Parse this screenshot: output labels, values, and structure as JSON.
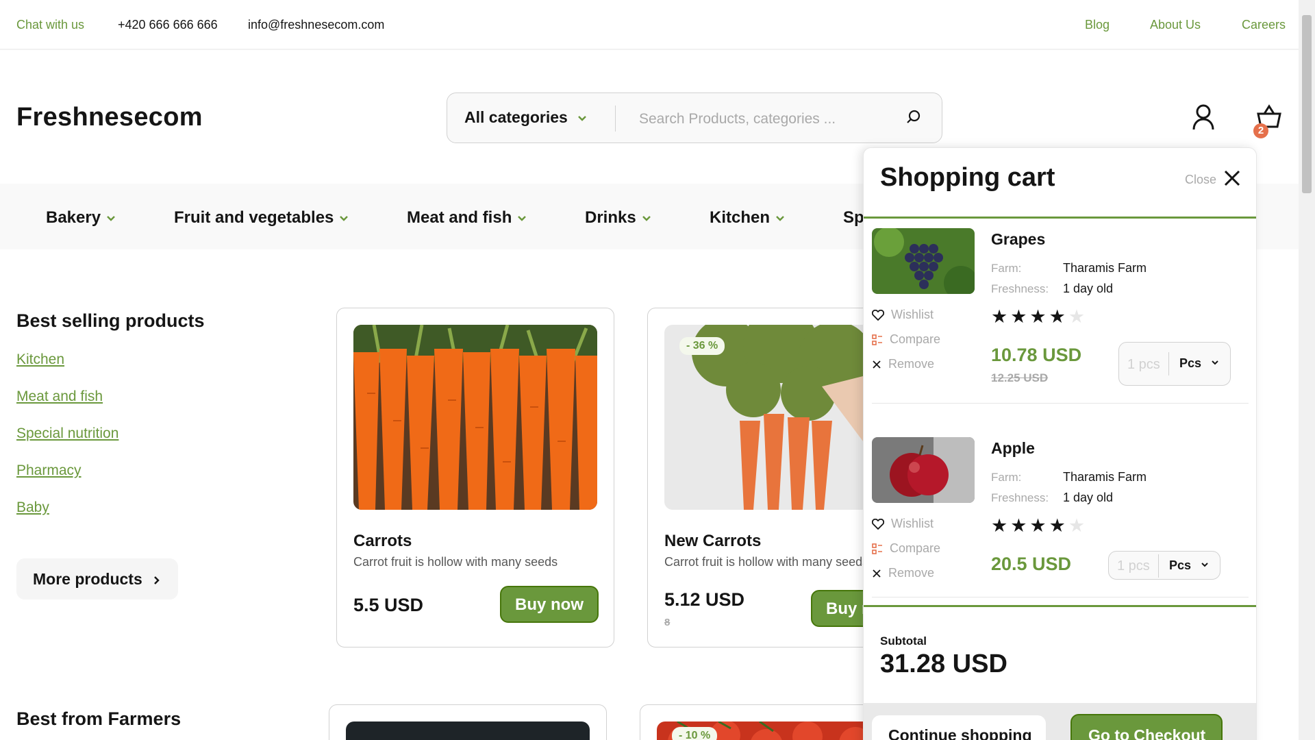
{
  "topbar": {
    "chat": "Chat with us",
    "phone": "+420 666 666 666",
    "email": "info@freshnesecom.com",
    "links": [
      "Blog",
      "About Us",
      "Careers"
    ]
  },
  "header": {
    "logo": "Freshnesecom",
    "category_label": "All categories",
    "search_placeholder": "Search Products, categories ...",
    "cart_count": "2"
  },
  "nav": [
    "Bakery",
    "Fruit and vegetables",
    "Meat and fish",
    "Drinks",
    "Kitchen",
    "Sp"
  ],
  "sidebar": {
    "title": "Best selling products",
    "links": [
      "Kitchen",
      "Meat and fish",
      "Special nutrition",
      "Pharmacy",
      "Baby"
    ],
    "more_button": "More products"
  },
  "products": [
    {
      "name": "Carrots",
      "desc": "Carrot fruit is hollow with many seeds",
      "price": "5.5 USD",
      "buy": "Buy now"
    },
    {
      "name": "New Carrots",
      "desc": "Carrot fruit is hollow with many seeds",
      "price": "5.12 USD",
      "old_price": "8",
      "discount": "- 36 %",
      "buy": "Buy now"
    }
  ],
  "section2": {
    "title": "Best from Farmers",
    "badge": "- 10 %"
  },
  "cart": {
    "title": "Shopping cart",
    "close_label": "Close",
    "farm_label": "Farm:",
    "freshness_label": "Freshness:",
    "actions": [
      "Wishlist",
      "Compare",
      "Remove"
    ],
    "items": [
      {
        "name": "Grapes",
        "farm": "Tharamis Farm",
        "freshness": "1 day old",
        "rating": 4,
        "rating_max": 5,
        "price": "10.78 USD",
        "old_price": "12.25 USD",
        "qty": "1 pcs",
        "unit": "Pcs"
      },
      {
        "name": "Apple",
        "farm": "Tharamis Farm",
        "freshness": "1 day old",
        "rating": 4,
        "rating_max": 5,
        "price": "20.5 USD",
        "qty": "1 pcs",
        "unit": "Pcs"
      }
    ],
    "subtotal_label": "Subtotal",
    "subtotal": "31.28 USD",
    "continue_button": "Continue shopping",
    "checkout_button": "Go to Checkout"
  },
  "colors": {
    "accent": "#6a983c",
    "accent_dark": "#46760a",
    "badge": "#e5704b",
    "muted": "#a9a9a9"
  }
}
